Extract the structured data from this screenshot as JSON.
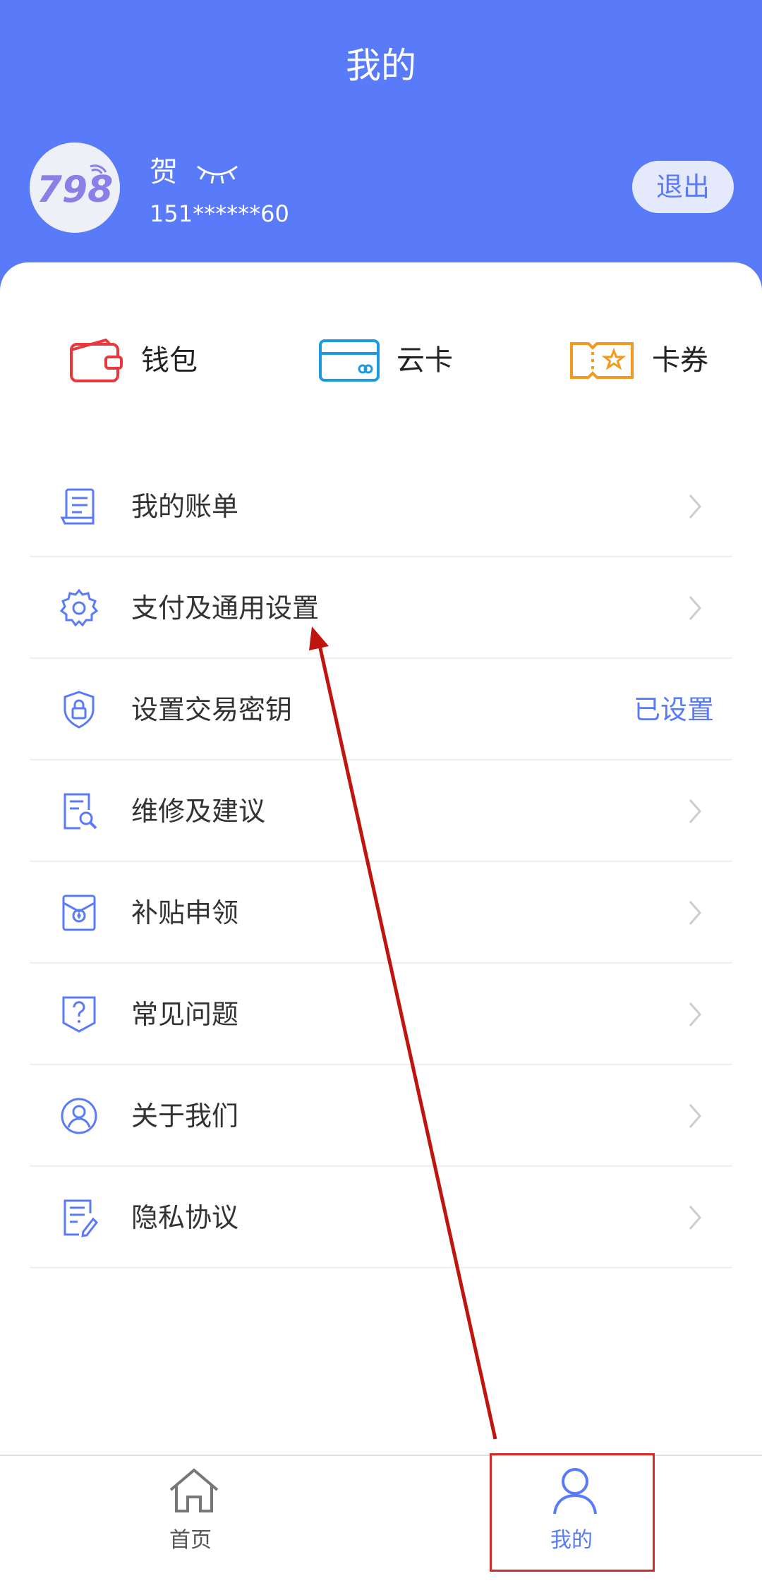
{
  "header": {
    "title": "我的",
    "user_name": "贺",
    "phone": "151******60",
    "logout_label": "退出",
    "background_color": "#5a7bf9"
  },
  "avatar": {
    "icon": "798-logo"
  },
  "quick_actions": [
    {
      "label": "钱包",
      "icon": "wallet-icon",
      "color": "#e8383d"
    },
    {
      "label": "云卡",
      "icon": "card-icon",
      "color": "#1e9bde"
    },
    {
      "label": "卡券",
      "icon": "coupon-icon",
      "color": "#f39a1e"
    }
  ],
  "menu": {
    "items": [
      {
        "label": "我的账单",
        "icon": "bill-icon"
      },
      {
        "label": "支付及通用设置",
        "icon": "gear-icon"
      },
      {
        "label": "设置交易密钥",
        "icon": "shield-lock-icon",
        "status": "已设置"
      },
      {
        "label": "维修及建议",
        "icon": "repair-icon"
      },
      {
        "label": "补贴申领",
        "icon": "subsidy-icon"
      },
      {
        "label": "常见问题",
        "icon": "question-icon"
      },
      {
        "label": "关于我们",
        "icon": "user-circle-icon"
      },
      {
        "label": "隐私协议",
        "icon": "document-edit-icon"
      }
    ]
  },
  "tabbar": {
    "tabs": [
      {
        "label": "首页",
        "icon": "home-icon",
        "active": false
      },
      {
        "label": "我的",
        "icon": "user-icon",
        "active": true
      }
    ],
    "active_color": "#5a7bf9",
    "inactive_color": "#555555"
  },
  "annotation": {
    "color": "#c0150f"
  }
}
